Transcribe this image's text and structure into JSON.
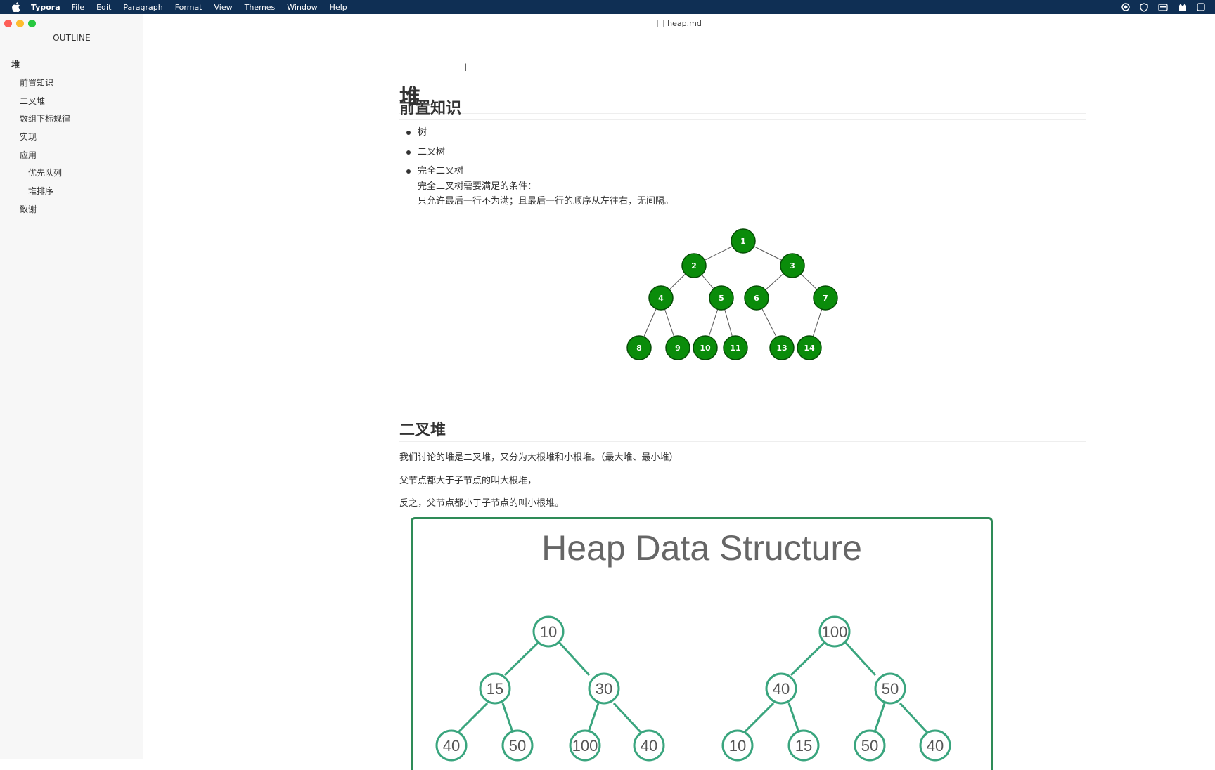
{
  "menubar": {
    "app_name": "Typora",
    "items": [
      "File",
      "Edit",
      "Paragraph",
      "Format",
      "View",
      "Themes",
      "Window",
      "Help"
    ]
  },
  "window": {
    "title": "heap.md"
  },
  "sidebar": {
    "title": "OUTLINE",
    "items": [
      {
        "label": "堆",
        "level": 1
      },
      {
        "label": "前置知识",
        "level": 2
      },
      {
        "label": "二叉堆",
        "level": 2
      },
      {
        "label": "数组下标规律",
        "level": 2
      },
      {
        "label": "实现",
        "level": 2
      },
      {
        "label": "应用",
        "level": 2
      },
      {
        "label": "优先队列",
        "level": 3
      },
      {
        "label": "堆排序",
        "level": 3
      },
      {
        "label": "致谢",
        "level": 2
      }
    ]
  },
  "doc": {
    "h1": "堆",
    "section1": {
      "title": "前置知识",
      "bullets": [
        "树",
        "二叉树",
        "完全二叉树"
      ],
      "note_line1": "完全二叉树需要满足的条件：",
      "note_line2": "只允许最后一行不为满；且最后一行的顺序从左往右，无间隔。"
    },
    "section2": {
      "title": "二叉堆",
      "p1": "我们讨论的堆是二叉堆，又分为大根堆和小根堆。（最大堆、最小堆）",
      "p2": "父节点都大于子节点的叫大根堆，",
      "p3": "反之，父节点都小于子节点的叫小根堆。"
    },
    "tree1": {
      "nodes": [
        "1",
        "2",
        "3",
        "4",
        "5",
        "6",
        "7",
        "8",
        "9",
        "10",
        "11",
        "13",
        "14"
      ],
      "fill": "#0a8c0a",
      "stroke": "#064d06"
    },
    "heap_image": {
      "title": "Heap Data Structure",
      "stroke": "#3aa57e",
      "min_heap": [
        "10",
        "15",
        "30",
        "40",
        "50",
        "100",
        "40"
      ],
      "max_heap": [
        "100",
        "40",
        "50",
        "10",
        "15",
        "50",
        "40"
      ]
    }
  }
}
